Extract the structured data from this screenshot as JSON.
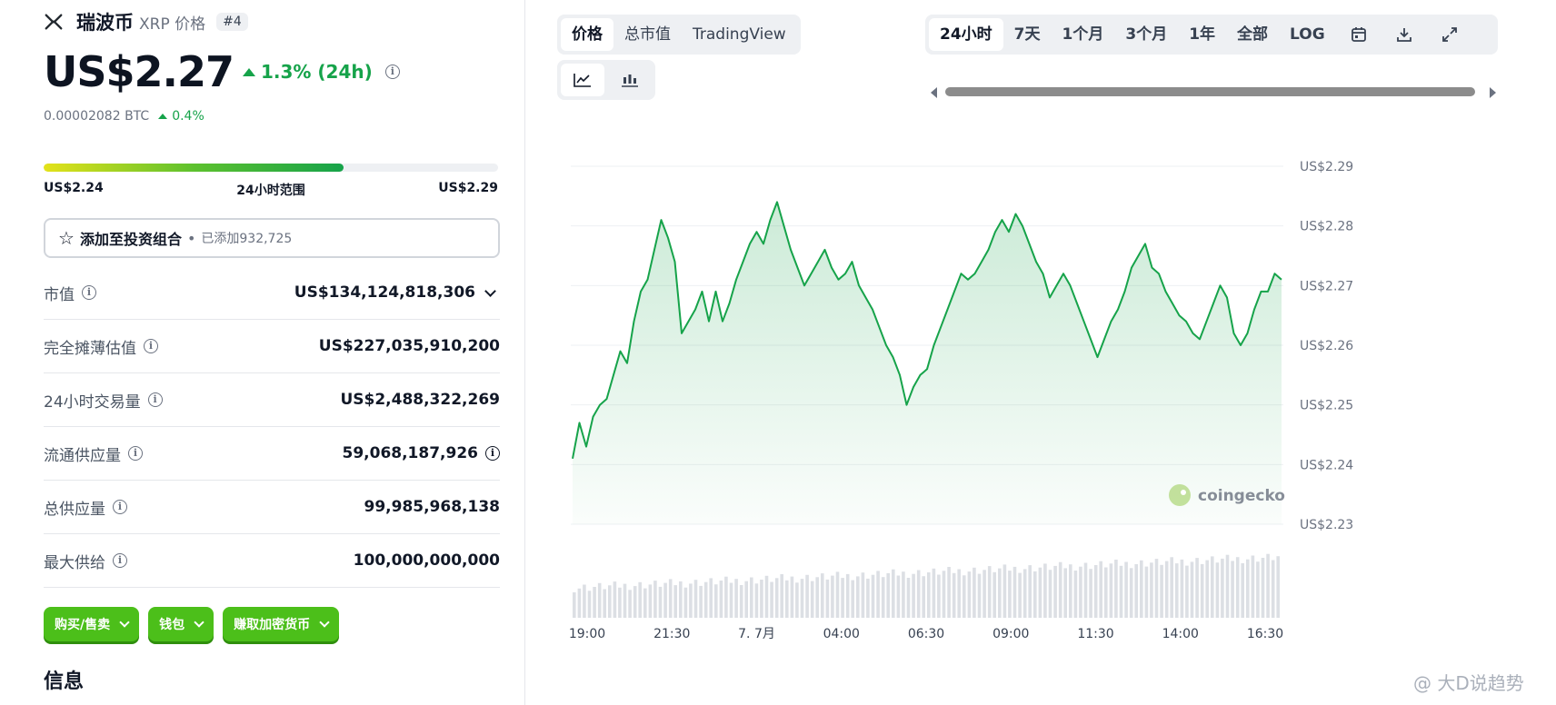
{
  "coin": {
    "name": "瑞波币",
    "symbol": "XRP 价格",
    "rank": "#4",
    "price": "US$2.27",
    "change_24h": "1.3% (24h)",
    "btc_price": "0.00002082 BTC",
    "btc_change": "0.4%"
  },
  "range24h": {
    "low": "US$2.24",
    "label": "24小时范围",
    "high": "US$2.29",
    "fill_fraction": 0.66
  },
  "portfolio": {
    "label": "添加至投资组合",
    "bullet": "•",
    "count": "已添加932,725"
  },
  "stats": [
    {
      "label": "市值",
      "value": "US$134,124,818,306"
    },
    {
      "label": "完全摊薄估值",
      "value": "US$227,035,910,200"
    },
    {
      "label": "24小时交易量",
      "value": "US$2,488,322,269"
    },
    {
      "label": "流通供应量",
      "value": "59,068,187,926"
    },
    {
      "label": "总供应量",
      "value": "99,985,968,138"
    },
    {
      "label": "最大供给",
      "value": "100,000,000,000"
    }
  ],
  "actions": {
    "buy_sell": "购买/售卖",
    "wallet": "钱包",
    "earn": "赚取加密货币"
  },
  "info_title": "信息",
  "chart_tabs": [
    "价格",
    "总市值",
    "TradingView"
  ],
  "time_ranges": [
    "24小时",
    "7天",
    "1个月",
    "3个月",
    "1年",
    "全部",
    "LOG"
  ],
  "watermark": "@ 大D说趋势",
  "colors": {
    "line": "#16a34a",
    "accent_green": "#4cbf1a",
    "volume": "#dcdfe4"
  },
  "chart_data": {
    "type": "area",
    "x_ticks": [
      "19:00",
      "21:30",
      "7. 7月",
      "04:00",
      "06:30",
      "09:00",
      "11:30",
      "14:00",
      "16:30"
    ],
    "y_ticks": [
      "US$2.29",
      "US$2.28",
      "US$2.27",
      "US$2.26",
      "US$2.25",
      "US$2.24",
      "US$2.23"
    ],
    "ylim": [
      2.23,
      2.29
    ],
    "grid": true,
    "brand": "coingecko",
    "series": [
      {
        "values": [
          2.241,
          2.247,
          2.243,
          2.248,
          2.25,
          2.251,
          2.255,
          2.259,
          2.257,
          2.264,
          2.269,
          2.271,
          2.276,
          2.281,
          2.278,
          2.274,
          2.262,
          2.264,
          2.266,
          2.269,
          2.264,
          2.269,
          2.264,
          2.267,
          2.271,
          2.274,
          2.277,
          2.279,
          2.277,
          2.281,
          2.284,
          2.28,
          2.276,
          2.273,
          2.27,
          2.272,
          2.274,
          2.276,
          2.273,
          2.271,
          2.272,
          2.274,
          2.27,
          2.268,
          2.266,
          2.263,
          2.26,
          2.258,
          2.255,
          2.25,
          2.253,
          2.255,
          2.256,
          2.26,
          2.263,
          2.266,
          2.269,
          2.272,
          2.271,
          2.272,
          2.274,
          2.276,
          2.279,
          2.281,
          2.279,
          2.282,
          2.28,
          2.277,
          2.274,
          2.272,
          2.268,
          2.27,
          2.272,
          2.27,
          2.267,
          2.264,
          2.261,
          2.258,
          2.261,
          2.264,
          2.266,
          2.269,
          2.273,
          2.275,
          2.277,
          2.273,
          2.272,
          2.269,
          2.267,
          2.265,
          2.264,
          2.262,
          2.261,
          2.264,
          2.267,
          2.27,
          2.268,
          2.262,
          2.26,
          2.262,
          2.266,
          2.269,
          2.269,
          2.272,
          2.271
        ]
      }
    ]
  }
}
